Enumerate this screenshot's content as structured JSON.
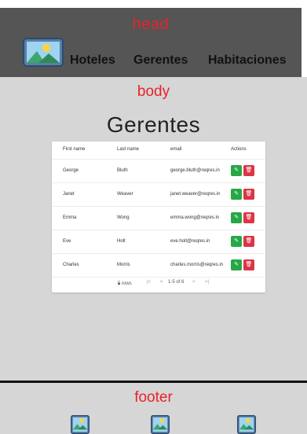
{
  "header": {
    "title": "head",
    "nav": [
      {
        "label": "Hoteles"
      },
      {
        "label": "Gerentes"
      },
      {
        "label": "Habitaciones"
      }
    ]
  },
  "body": {
    "title": "body",
    "page_title": "Gerentes",
    "table": {
      "columns": [
        "First name",
        "Last name",
        "email",
        "Actions"
      ],
      "rows": [
        {
          "first_name": "George",
          "last_name": "Bluth",
          "email": "george.bluth@reqres.in"
        },
        {
          "first_name": "Janet",
          "last_name": "Weaver",
          "email": "janet.weaver@reqres.in"
        },
        {
          "first_name": "Emma",
          "last_name": "Wong",
          "email": "emma.wong@reqres.in"
        },
        {
          "first_name": "Eve",
          "last_name": "Holt",
          "email": "eve.holt@reqres.in"
        },
        {
          "first_name": "Charles",
          "last_name": "Morris",
          "email": "charles.morris@reqres.in"
        }
      ],
      "pagination": {
        "rows_select": "5 rows",
        "range": "1-5 of 6"
      }
    }
  },
  "footer": {
    "title": "footer"
  },
  "colors": {
    "header_bg": "#555555",
    "panel_bg": "#d6d6d6",
    "label_red": "#e8232b",
    "edit_green": "#28a745",
    "delete_red": "#dc3545"
  },
  "icons": [
    "image-icon",
    "edit-icon",
    "delete-icon",
    "first-page-icon",
    "prev-page-icon",
    "next-page-icon",
    "last-page-icon",
    "dropdown-icon"
  ]
}
